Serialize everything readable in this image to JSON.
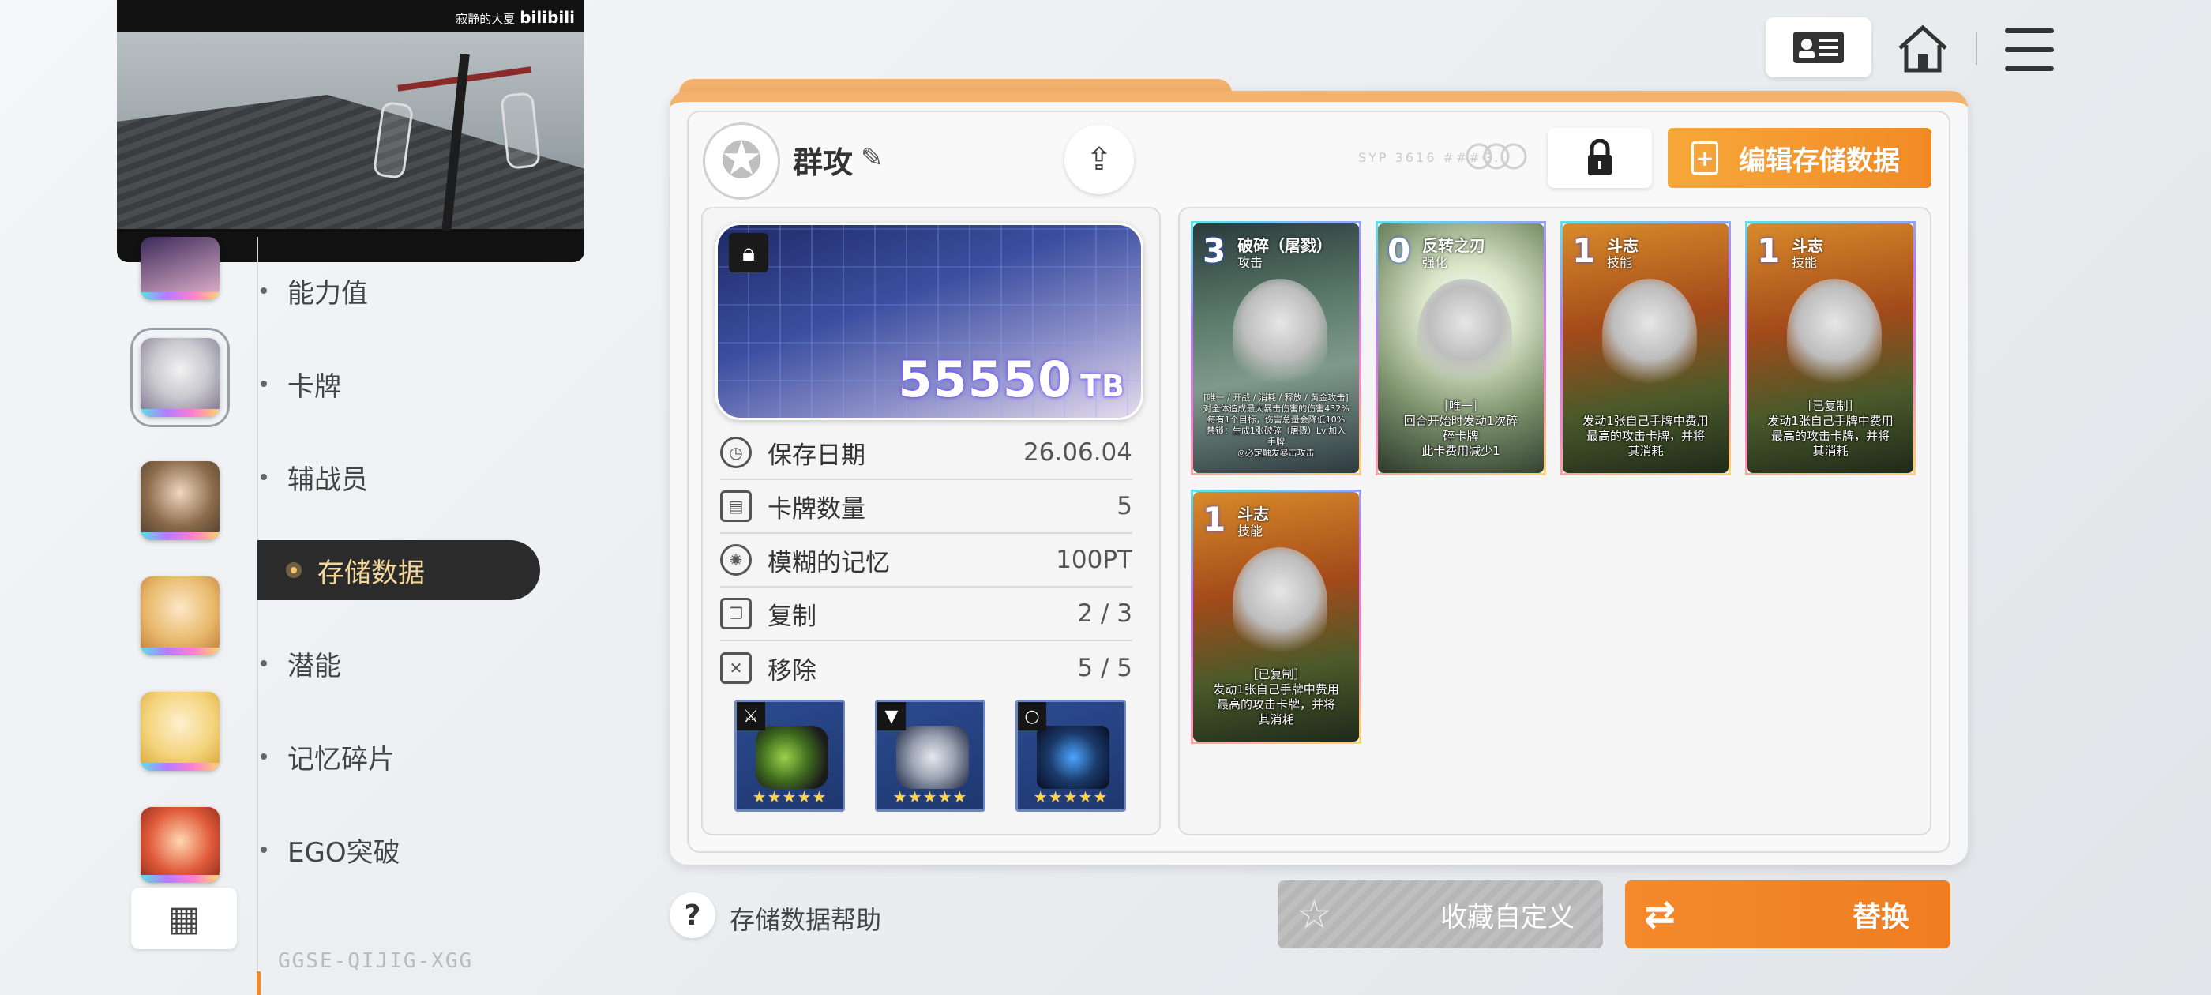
{
  "video": {
    "credit": "寂静的大夏",
    "brand": "bilibili"
  },
  "sidebar": {
    "items": [
      {
        "label": "能力值"
      },
      {
        "label": "卡牌"
      },
      {
        "label": "辅战员"
      },
      {
        "label": "存储数据",
        "active": true
      },
      {
        "label": "潜能"
      },
      {
        "label": "记忆碎片"
      },
      {
        "label": "EGO突破"
      }
    ],
    "grid_icon": "grid-icon",
    "version": "GGSE-QIJIG-XGG"
  },
  "topbar": {
    "id_icon": "id-card-icon",
    "home_icon": "home-icon",
    "menu_icon": "hamburger-menu-icon"
  },
  "deck": {
    "name": "群攻",
    "edit_save_label": "编辑存储数据",
    "faint_text": "SYP 3616 ###G.",
    "card_value": "55550",
    "card_unit": "TB",
    "stats": [
      {
        "label": "保存日期",
        "value": "26.06.04"
      },
      {
        "label": "卡牌数量",
        "value": "5"
      },
      {
        "label": "模糊的记忆",
        "value": "100PT"
      },
      {
        "label": "复制",
        "value": "2 / 3"
      },
      {
        "label": "移除",
        "value": "5 / 5"
      }
    ],
    "equipment": [
      {
        "slot": "weapon",
        "stars": "★★★★★"
      },
      {
        "slot": "armor",
        "stars": "★★★★★"
      },
      {
        "slot": "accessory",
        "stars": "★★★★★"
      }
    ]
  },
  "cards": [
    {
      "cost": "3",
      "name": "破碎（屠戮）",
      "type": "攻击",
      "desc": "[唯一 / 开战 / 消耗 / 释放 / 黄金攻击]\n对全体造成最大暴击伤害的伤害432%\n每有1个目标，伤害总量会降低10%\n禁锁：生成1张破碎（屠戮）Lv.加入\n手牌\n◎必定触发暴击攻击"
    },
    {
      "cost": "0",
      "name": "反转之刃",
      "type": "强化",
      "desc": "［唯一］\n回合开始时发动1次碎\n碎卡牌\n此卡费用减少1"
    },
    {
      "cost": "1",
      "name": "斗志",
      "type": "技能",
      "desc": "发动1张自己手牌中费用\n最高的攻击卡牌，并将\n其消耗"
    },
    {
      "cost": "1",
      "name": "斗志",
      "type": "技能",
      "desc": "［已复制］\n发动1张自己手牌中费用\n最高的攻击卡牌，并将\n其消耗"
    },
    {
      "cost": "1",
      "name": "斗志",
      "type": "技能",
      "desc": "［已复制］\n发动1张自己手牌中费用\n最高的攻击卡牌，并将\n其消耗"
    }
  ],
  "bottom": {
    "help_label": "存储数据帮助",
    "favorite_label": "收藏自定义",
    "replace_label": "替换"
  }
}
